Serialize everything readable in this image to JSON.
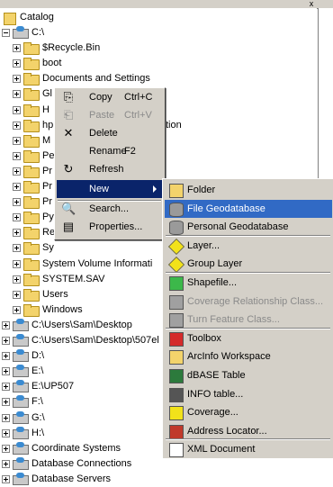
{
  "window": {
    "close_glyph": "x"
  },
  "tree": {
    "root_label": "Catalog",
    "items": [
      {
        "label": "C:\\",
        "kind": "drive",
        "indent": 1,
        "expander": "minus"
      },
      {
        "label": "$Recycle.Bin",
        "kind": "folder",
        "indent": 2
      },
      {
        "label": "boot",
        "kind": "folder",
        "indent": 2
      },
      {
        "label": "Documents and Settings",
        "kind": "folder",
        "indent": 2
      },
      {
        "label": "Gl",
        "kind": "folder",
        "indent": 2
      },
      {
        "label": "H",
        "kind": "folder",
        "indent": 2
      },
      {
        "label": "hp",
        "kind": "folder",
        "indent": 2,
        "suffix": "tion"
      },
      {
        "label": "M",
        "kind": "folder",
        "indent": 2
      },
      {
        "label": "Pe",
        "kind": "folder",
        "indent": 2
      },
      {
        "label": "Pr",
        "kind": "folder",
        "indent": 2
      },
      {
        "label": "Pr",
        "kind": "folder",
        "indent": 2
      },
      {
        "label": "Pr",
        "kind": "folder",
        "indent": 2
      },
      {
        "label": "Py",
        "kind": "folder",
        "indent": 2
      },
      {
        "label": "Re",
        "kind": "folder",
        "indent": 2
      },
      {
        "label": "Sy",
        "kind": "folder",
        "indent": 2
      },
      {
        "label": "System Volume Informati",
        "kind": "folder",
        "indent": 2
      },
      {
        "label": "SYSTEM.SAV",
        "kind": "folder",
        "indent": 2
      },
      {
        "label": "Users",
        "kind": "folder",
        "indent": 2
      },
      {
        "label": "Windows",
        "kind": "folder",
        "indent": 2
      },
      {
        "label": "C:\\Users\\Sam\\Desktop",
        "kind": "drive",
        "indent": 1
      },
      {
        "label": "C:\\Users\\Sam\\Desktop\\507el",
        "kind": "drive",
        "indent": 1
      },
      {
        "label": "D:\\",
        "kind": "drive",
        "indent": 1
      },
      {
        "label": "E:\\",
        "kind": "drive",
        "indent": 1
      },
      {
        "label": "E:\\UP507",
        "kind": "drive",
        "indent": 1
      },
      {
        "label": "F:\\",
        "kind": "drive",
        "indent": 1
      },
      {
        "label": "G:\\",
        "kind": "drive",
        "indent": 1
      },
      {
        "label": "H:\\",
        "kind": "drive",
        "indent": 1
      },
      {
        "label": "Coordinate Systems",
        "kind": "drive",
        "indent": 1
      },
      {
        "label": "Database Connections",
        "kind": "drive",
        "indent": 1
      },
      {
        "label": "Database Servers",
        "kind": "drive",
        "indent": 1
      }
    ]
  },
  "context_menu": {
    "items": [
      {
        "name": "copy",
        "label": "Copy",
        "shortcut": "Ctrl+C",
        "icon": "copy-icon",
        "glyph": "⎘",
        "disabled": false
      },
      {
        "name": "paste",
        "label": "Paste",
        "shortcut": "Ctrl+V",
        "icon": "paste-icon",
        "glyph": "⎗",
        "disabled": true
      },
      {
        "name": "delete",
        "label": "Delete",
        "shortcut": "",
        "icon": "delete-icon",
        "glyph": "✕",
        "disabled": false
      },
      {
        "name": "rename",
        "label": "Rename",
        "shortcut": "F2",
        "icon": "",
        "glyph": "",
        "disabled": false
      },
      {
        "name": "refresh",
        "label": "Refresh",
        "shortcut": "",
        "icon": "refresh-icon",
        "glyph": "↻",
        "disabled": false
      },
      {
        "name": "new",
        "label": "New",
        "shortcut": "",
        "icon": "",
        "glyph": "",
        "disabled": false,
        "highlighted": true,
        "submenu": true
      },
      {
        "name": "search",
        "label": "Search...",
        "shortcut": "",
        "icon": "search-icon",
        "glyph": "🔍",
        "disabled": false
      },
      {
        "name": "properties",
        "label": "Properties...",
        "shortcut": "",
        "icon": "properties-icon",
        "glyph": "▤",
        "disabled": false
      }
    ]
  },
  "new_submenu": {
    "items": [
      {
        "name": "folder",
        "label": "Folder",
        "icon": "folder-icon",
        "color": "#f3d36b"
      },
      {
        "name": "file-geodatabase",
        "label": "File Geodatabase",
        "icon": "geodatabase-icon",
        "color": "#9a9a9a",
        "highlighted": true
      },
      {
        "name": "personal-geodatabase",
        "label": "Personal Geodatabase",
        "icon": "geodatabase-icon",
        "color": "#9a9a9a"
      },
      {
        "name": "layer",
        "label": "Layer...",
        "icon": "layer-icon",
        "color": "#f2e21a"
      },
      {
        "name": "group-layer",
        "label": "Group Layer",
        "icon": "group-layer-icon",
        "color": "#f2e21a"
      },
      {
        "name": "shapefile",
        "label": "Shapefile...",
        "icon": "shapefile-icon",
        "color": "#3cb84a"
      },
      {
        "name": "coverage-relationship-class",
        "label": "Coverage Relationship Class...",
        "icon": "relationship-icon",
        "color": "#a0a0a0",
        "disabled": true
      },
      {
        "name": "turn-feature-class",
        "label": "Turn Feature Class...",
        "icon": "turn-feature-icon",
        "color": "#a0a0a0",
        "disabled": true
      },
      {
        "name": "toolbox",
        "label": "Toolbox",
        "icon": "toolbox-icon",
        "color": "#d42a2a"
      },
      {
        "name": "arcinfo-workspace",
        "label": "ArcInfo Workspace",
        "icon": "workspace-icon",
        "color": "#f3d36b"
      },
      {
        "name": "dbase-table",
        "label": "dBASE Table",
        "icon": "table-icon",
        "color": "#2c7a3c"
      },
      {
        "name": "info-table",
        "label": "INFO table...",
        "icon": "info-table-icon",
        "color": "#555555"
      },
      {
        "name": "coverage",
        "label": "Coverage...",
        "icon": "coverage-icon",
        "color": "#f2e21a"
      },
      {
        "name": "address-locator",
        "label": "Address Locator...",
        "icon": "address-locator-icon",
        "color": "#c0392b"
      },
      {
        "name": "xml-document",
        "label": "XML Document",
        "icon": "xml-icon",
        "color": "#ffffff"
      }
    ]
  }
}
